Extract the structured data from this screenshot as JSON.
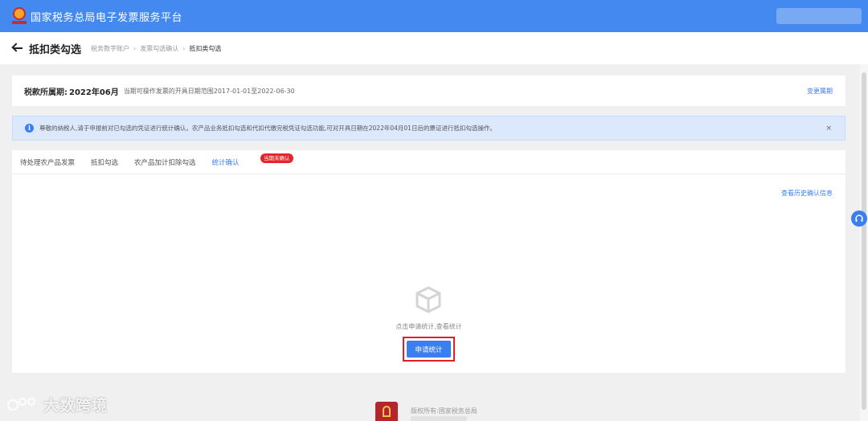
{
  "header": {
    "app_title": "国家税务总局电子发票服务平台"
  },
  "titlebar": {
    "title": "抵扣类勾选",
    "breadcrumb": [
      "税务数字账户",
      "发票勾选确认",
      "抵扣类勾选"
    ]
  },
  "period": {
    "label": "税款所属期:",
    "value": "2022年06月",
    "range_text": "当期可操作发票的开具日期范围2017-01-01至2022-06-30",
    "change_link": "变更属期"
  },
  "notice": {
    "text": "尊敬的纳税人,请于申报前对已勾选的凭证进行统计确认。农产品业务抵扣勾选和代扣代缴完税凭证勾选功能,可对开具日期在2022年04月01日后的票证进行抵扣勾选操作。",
    "close": "×"
  },
  "tabs": [
    {
      "label": "待处理农产品发票",
      "active": false
    },
    {
      "label": "抵扣勾选",
      "active": false
    },
    {
      "label": "农产品加计扣除勾选",
      "active": false
    },
    {
      "label": "统计确认",
      "active": true
    }
  ],
  "tab_badge": "当期未确认",
  "history_link": "查看历史确认信息",
  "empty_state": {
    "icon": "empty-box-icon",
    "text": "点击申请统计,查看统计",
    "button": "申请统计"
  },
  "footer": {
    "copyright": "版权所有:国家税务总局"
  },
  "watermark": "大数跨境",
  "colors": {
    "primary": "#3a7ef0",
    "header_bg": "#4489f0",
    "badge": "#e5232a",
    "highlight_border": "#e01e26"
  }
}
